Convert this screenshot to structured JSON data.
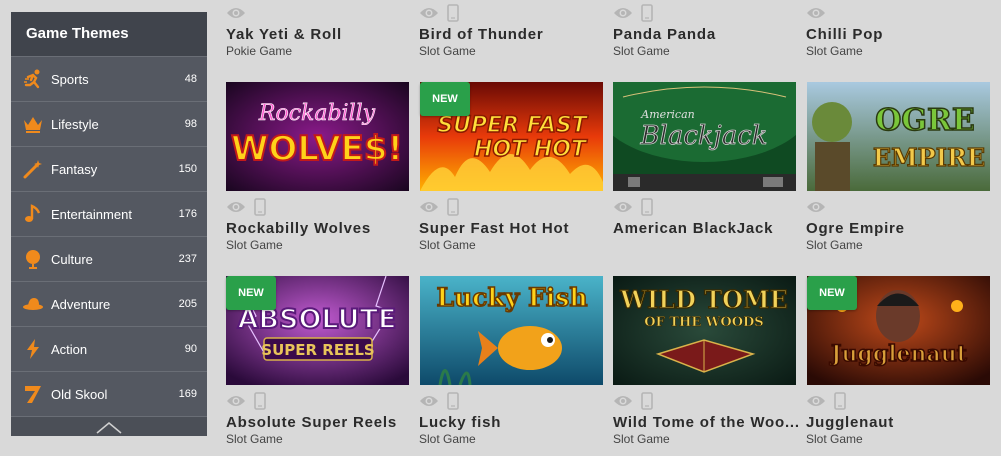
{
  "sidebar": {
    "title": "Game Themes",
    "items": [
      {
        "label": "Sports",
        "count": "48",
        "icon": "runner-icon"
      },
      {
        "label": "Lifestyle",
        "count": "98",
        "icon": "crown-icon"
      },
      {
        "label": "Fantasy",
        "count": "150",
        "icon": "magic-wand-icon"
      },
      {
        "label": "Entertainment",
        "count": "176",
        "icon": "music-note-icon"
      },
      {
        "label": "Culture",
        "count": "237",
        "icon": "globe-icon"
      },
      {
        "label": "Adventure",
        "count": "205",
        "icon": "hat-icon"
      },
      {
        "label": "Action",
        "count": "90",
        "icon": "lightning-icon"
      },
      {
        "label": "Old Skool",
        "count": "169",
        "icon": "seven-icon"
      }
    ],
    "accent": "#f08a1c"
  },
  "top_row": [
    {
      "title": "Yak Yeti & Roll",
      "type": "Pokie Game"
    },
    {
      "title": "Bird of Thunder",
      "type": "Slot Game"
    },
    {
      "title": "Panda Panda",
      "type": "Slot Game"
    },
    {
      "title": "Chilli Pop",
      "type": "Slot Game"
    }
  ],
  "games": [
    {
      "title": "Rockabilly Wolves",
      "type": "Slot Game",
      "thumb_text": "Rockabilly WOLVES!",
      "is_new": false
    },
    {
      "title": "Super Fast Hot Hot",
      "type": "Slot Game",
      "thumb_text": "SUPER FAST HOT HOT",
      "is_new": true
    },
    {
      "title": "American BlackJack",
      "type": "",
      "thumb_text": "American Blackjack",
      "is_new": false
    },
    {
      "title": "Ogre Empire",
      "type": "Slot Game",
      "thumb_text": "OGRE EMPIRE",
      "is_new": false
    },
    {
      "title": "Absolute Super Reels",
      "type": "Slot Game",
      "thumb_text": "ABSOLUTE SUPER REELS",
      "is_new": true
    },
    {
      "title": "Lucky fish",
      "type": "Slot Game",
      "thumb_text": "Lucky Fish",
      "is_new": false
    },
    {
      "title": "Wild Tome of the Woo...",
      "type": "Slot Game",
      "thumb_text": "WILD TOME OF THE WOODS",
      "is_new": false
    },
    {
      "title": "Jugglenaut",
      "type": "Slot Game",
      "thumb_text": "Jugglenaut",
      "is_new": true
    }
  ],
  "new_badge": "NEW",
  "colors": {
    "new_badge": "#2aa04a",
    "background": "#d9d9d9",
    "sidebar": "#545861"
  }
}
